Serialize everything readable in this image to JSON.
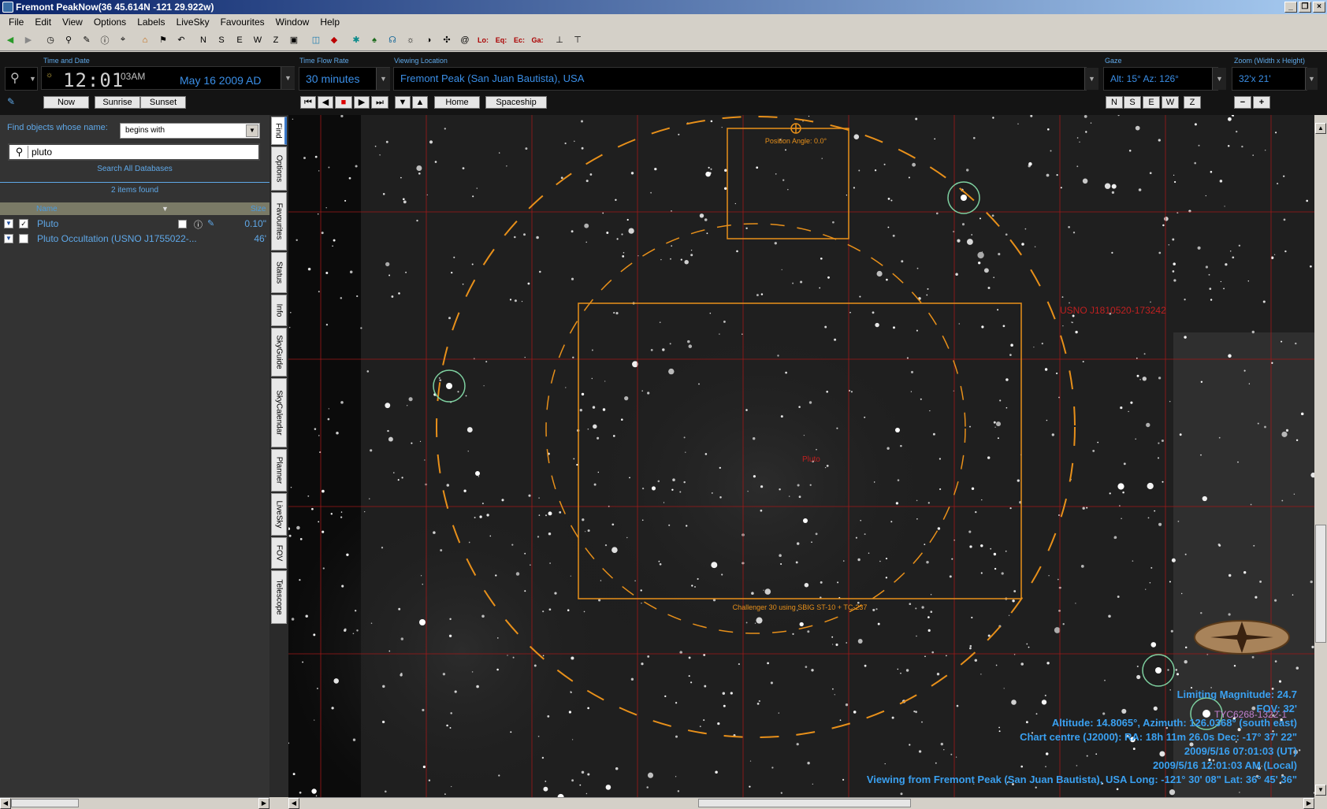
{
  "window": {
    "title": "Fremont PeakNow(36  45.614N  -121 29.922w)"
  },
  "menu": [
    "File",
    "Edit",
    "View",
    "Options",
    "Labels",
    "LiveSky",
    "Favourites",
    "Window",
    "Help"
  ],
  "toolbar_text": {
    "lo": "Lo:",
    "eq": "Eq:",
    "ec": "Ec:",
    "ga": "Ga:"
  },
  "controls": {
    "time_label": "Time and Date",
    "time": "12:01",
    "ampm": "03AM",
    "date": "May 16  2009 AD",
    "now": "Now",
    "sunrise": "Sunrise",
    "sunset": "Sunset",
    "flow_label": "Time Flow Rate",
    "flow": "30 minutes",
    "home": "Home",
    "spaceship": "Spaceship",
    "location_label": "Viewing Location",
    "location": "Fremont Peak (San Juan Bautista), USA",
    "gaze_label": "Gaze",
    "gaze": "Alt: 15° Az: 126°",
    "compass": [
      "N",
      "S",
      "E",
      "W",
      "Z"
    ],
    "zoom_label": "Zoom (Width x Height)",
    "zoom": "32'x 21'",
    "zoom_out": "−",
    "zoom_in": "+"
  },
  "find": {
    "label": "Find objects whose name:",
    "mode": "begins with",
    "query": "pluto",
    "search_all": "Search All Databases",
    "items_found": "2 items found",
    "header_name": "Name",
    "header_size": "Size",
    "results": [
      {
        "name": "Pluto",
        "size": "0.10\"",
        "checked": true
      },
      {
        "name": "Pluto Occultation (USNO J1755022-...",
        "size": "46'",
        "checked": false
      }
    ]
  },
  "tabs": [
    "Find",
    "Options",
    "Favourites",
    "Status",
    "Info",
    "SkyGuide",
    "SkyCalendar",
    "Planner",
    "LiveSky",
    "FOV",
    "Telescope"
  ],
  "sky": {
    "position_angle": "Position Angle: 0.0°",
    "ccd_label": "Challenger 30 using SBIG ST-10 + TC-237",
    "usno_label": "USNO J1810520-173242",
    "pluto_label": "Pluto",
    "tyc_label": "TYC6268-1322-1",
    "limiting_magnitude": "Limiting Magnitude: 24.7",
    "fov": "FOV: 32'",
    "altaz": "Altitude: 14.8065°, Azimuth: 126.0368° (south east)",
    "chart_centre": "Chart centre (J2000): RA: 18h 11m 26.0s Dec: -17° 37' 22\"",
    "ut_time": "2009/5/16 07:01:03 (UT)",
    "local_time": "2009/5/16 12:01:03 AM (Local)",
    "viewing_from": "Viewing from Fremont Peak (San Juan Bautista), USA    Long: -121° 30' 08\" Lat: 36° 45' 36\""
  },
  "colors": {
    "accent_blue": "#3aa0f0",
    "fov_orange": "#e8901a",
    "grid_red": "#b01818"
  }
}
